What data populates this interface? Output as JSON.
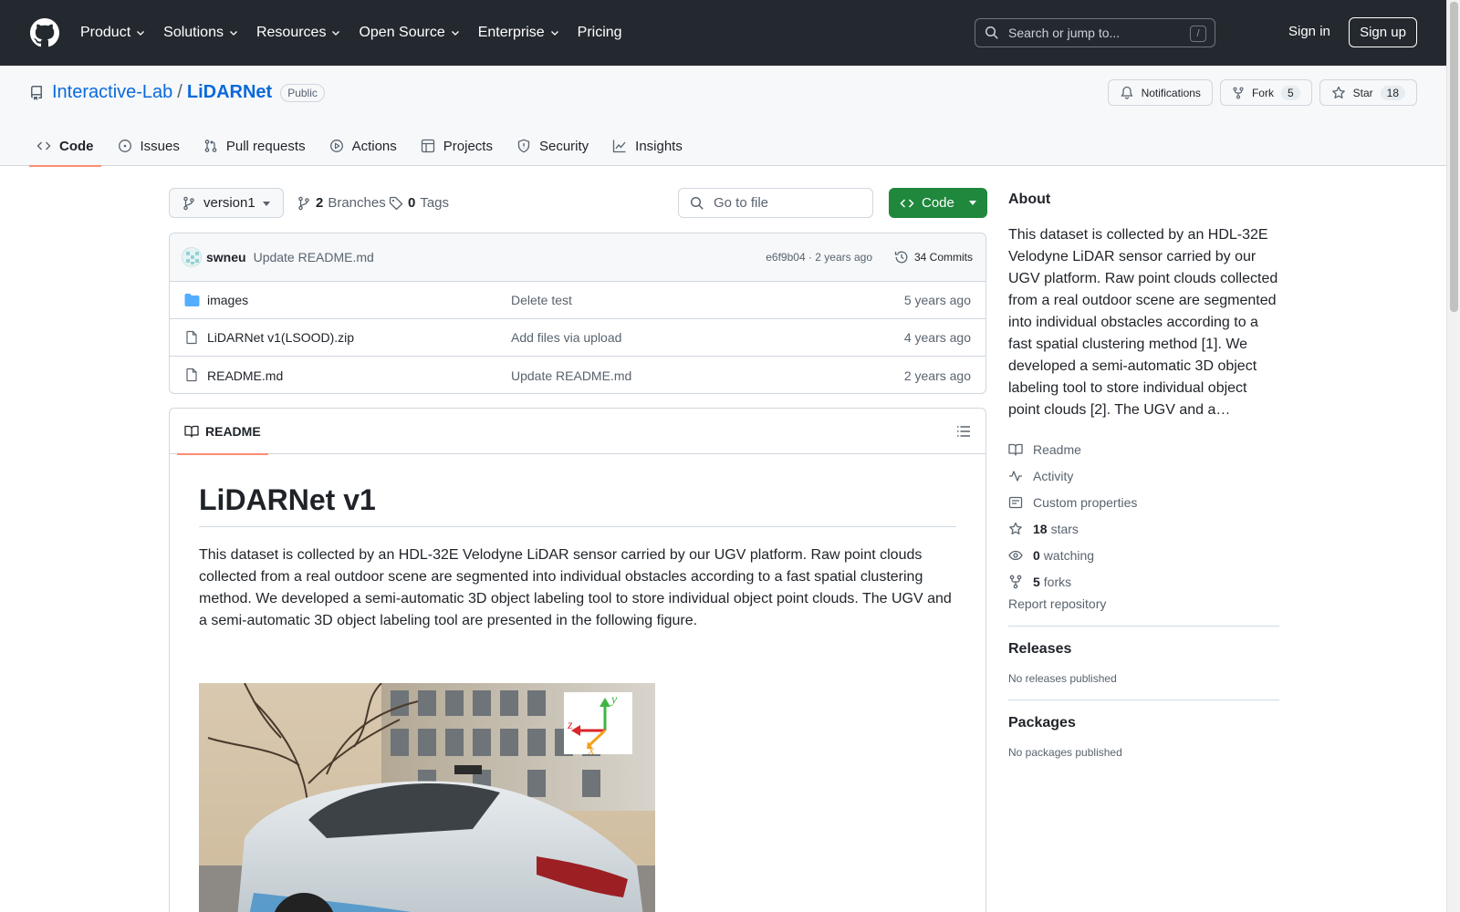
{
  "header": {
    "nav": [
      {
        "label": "Product",
        "has_menu": true
      },
      {
        "label": "Solutions",
        "has_menu": true
      },
      {
        "label": "Resources",
        "has_menu": true
      },
      {
        "label": "Open Source",
        "has_menu": true
      },
      {
        "label": "Enterprise",
        "has_menu": true
      },
      {
        "label": "Pricing",
        "has_menu": false
      }
    ],
    "search_placeholder": "Search or jump to...",
    "search_shortcut": "/",
    "sign_in": "Sign in",
    "sign_up": "Sign up"
  },
  "repo": {
    "owner": "Interactive-Lab",
    "separator": "/",
    "name": "LiDARNet",
    "visibility": "Public",
    "notifications_label": "Notifications",
    "fork_label": "Fork",
    "fork_count": "5",
    "star_label": "Star",
    "star_count": "18",
    "tabs": [
      {
        "label": "Code",
        "icon": "code-icon",
        "active": true
      },
      {
        "label": "Issues",
        "icon": "issue-icon",
        "active": false
      },
      {
        "label": "Pull requests",
        "icon": "pull-request-icon",
        "active": false
      },
      {
        "label": "Actions",
        "icon": "play-icon",
        "active": false
      },
      {
        "label": "Projects",
        "icon": "table-icon",
        "active": false
      },
      {
        "label": "Security",
        "icon": "shield-icon",
        "active": false
      },
      {
        "label": "Insights",
        "icon": "graph-icon",
        "active": false
      }
    ]
  },
  "toolbar": {
    "branch": "version1",
    "branches_count": "2",
    "branches_label": "Branches",
    "tags_count": "0",
    "tags_label": "Tags",
    "goto_placeholder": "Go to file",
    "code_button": "Code"
  },
  "commit": {
    "author": "swneu",
    "message": "Update README.md",
    "meta": "e6f9b04 · 2 years ago",
    "count_label": "34 Commits"
  },
  "files": [
    {
      "name": "images",
      "type": "folder",
      "message": "Delete test",
      "date": "5 years ago"
    },
    {
      "name": "LiDARNet v1(LSOOD).zip",
      "type": "file",
      "message": "Add files via upload",
      "date": "4 years ago"
    },
    {
      "name": "README.md",
      "type": "file",
      "message": "Update README.md",
      "date": "2 years ago"
    }
  ],
  "readme": {
    "tab_label": "README",
    "title": "LiDARNet v1",
    "paragraph": "This dataset is collected by an HDL-32E Velodyne LiDAR sensor carried by our UGV platform. Raw point clouds collected from a real outdoor scene are segmented into individual obstacles according to a fast spatial clustering method. We developed a semi-automatic 3D object labeling tool to store individual object point clouds. The UGV and a semi-automatic 3D object labeling tool are presented in the following figure.",
    "figure_axes": {
      "y": "y",
      "z": "z",
      "x": "x"
    }
  },
  "sidebar": {
    "about_title": "About",
    "about_text": "This dataset is collected by an HDL-32E Velodyne LiDAR sensor carried by our UGV platform. Raw point clouds collected from a real outdoor scene are segmented into individual obstacles according to a fast spatial clustering method [1]. We developed a semi-automatic 3D object labeling tool to store individual object point clouds [2]. The UGV and a…",
    "readme_link": "Readme",
    "activity_link": "Activity",
    "custom_props_link": "Custom properties",
    "stars_count": "18",
    "stars_label": "stars",
    "watching_count": "0",
    "watching_label": "watching",
    "forks_count": "5",
    "forks_label": "forks",
    "report_link": "Report repository",
    "releases_title": "Releases",
    "releases_empty": "No releases published",
    "packages_title": "Packages",
    "packages_empty": "No packages published"
  },
  "colors": {
    "header_bg": "#24292f",
    "link": "#0969da",
    "primary_button": "#1f883d",
    "active_tab_underline": "#fd8c73",
    "folder_icon": "#54aeff"
  }
}
